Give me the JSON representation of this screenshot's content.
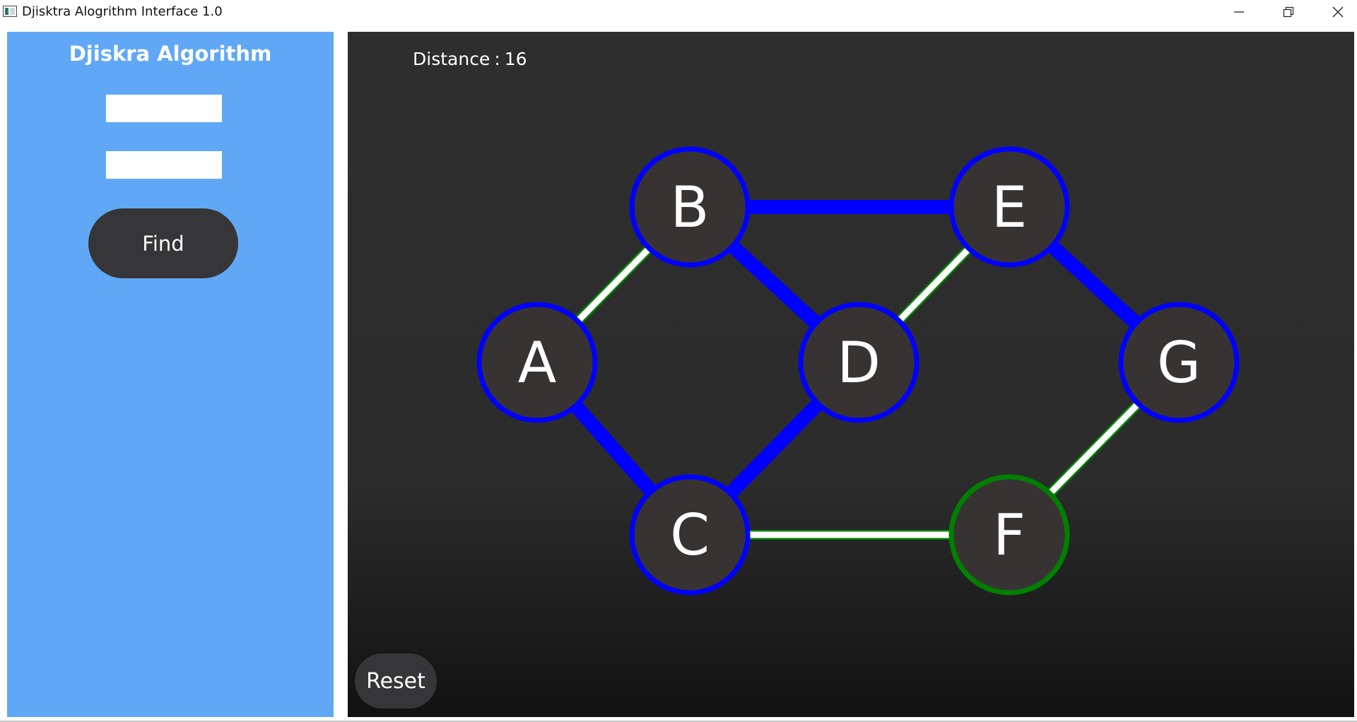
{
  "window": {
    "title": "Djisktra Alogrithm Interface 1.0",
    "controls": [
      "minimize",
      "restore",
      "close"
    ]
  },
  "sidebar": {
    "title": "Djiskra Algorithm",
    "source_field": {
      "value": "",
      "placeholder": ""
    },
    "target_field": {
      "value": "",
      "placeholder": ""
    },
    "find_label": "Find",
    "background_color": "#60a8f5"
  },
  "canvas": {
    "distance_label": "Distance",
    "distance_separator": ":",
    "distance_value": "16",
    "reset_label": "Reset"
  },
  "graph": {
    "colors": {
      "path": "#0000ff",
      "unvisited_edge": "#ffffff",
      "unvisited_edge_outline": "#008000",
      "node_fill": "#383333",
      "path_node_ring": "#0000ff",
      "other_node_ring": "#008000"
    },
    "nodes": [
      {
        "id": "A",
        "label": "A",
        "state": "path"
      },
      {
        "id": "B",
        "label": "B",
        "state": "path"
      },
      {
        "id": "C",
        "label": "C",
        "state": "path"
      },
      {
        "id": "D",
        "label": "D",
        "state": "path"
      },
      {
        "id": "E",
        "label": "E",
        "state": "path"
      },
      {
        "id": "F",
        "label": "F",
        "state": "other"
      },
      {
        "id": "G",
        "label": "G",
        "state": "path"
      }
    ],
    "edges": [
      {
        "from": "A",
        "to": "B",
        "state": "other"
      },
      {
        "from": "A",
        "to": "C",
        "state": "path"
      },
      {
        "from": "B",
        "to": "D",
        "state": "path"
      },
      {
        "from": "B",
        "to": "E",
        "state": "path"
      },
      {
        "from": "C",
        "to": "D",
        "state": "path"
      },
      {
        "from": "C",
        "to": "F",
        "state": "other"
      },
      {
        "from": "D",
        "to": "E",
        "state": "other"
      },
      {
        "from": "E",
        "to": "G",
        "state": "path"
      },
      {
        "from": "F",
        "to": "G",
        "state": "other"
      }
    ]
  }
}
